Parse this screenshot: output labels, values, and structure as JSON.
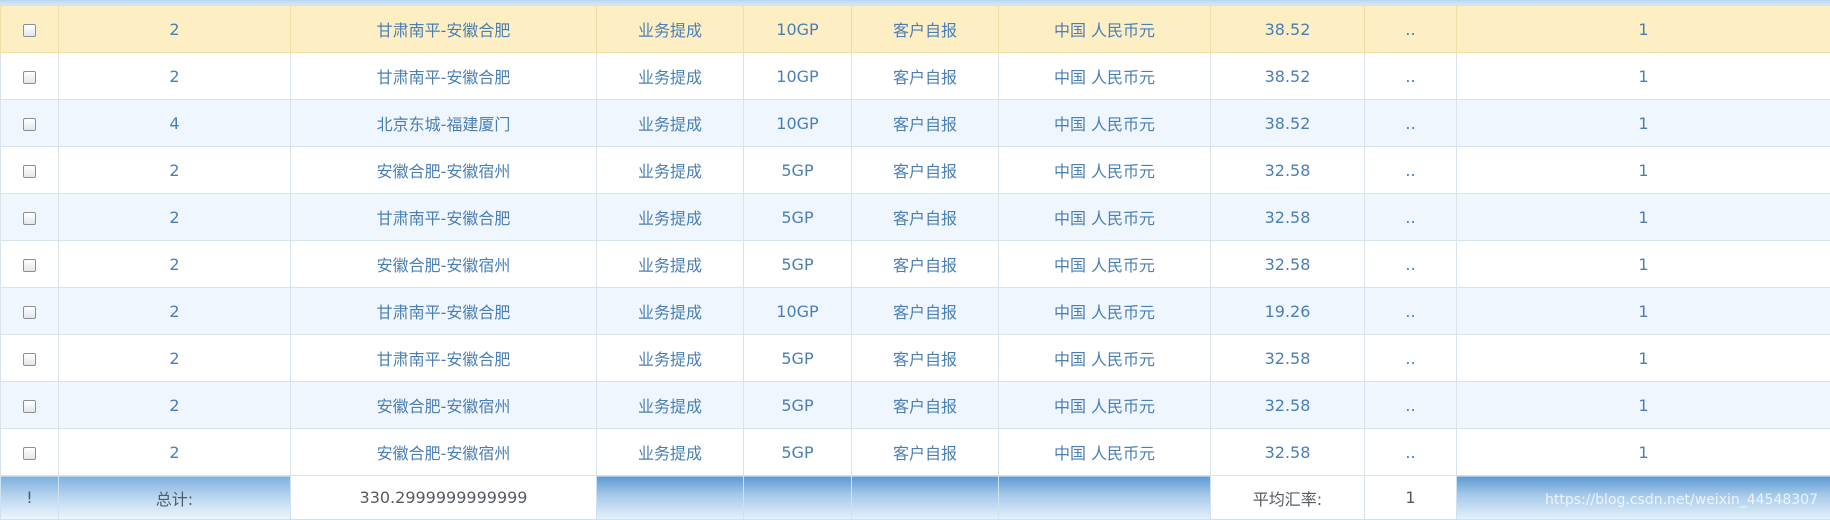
{
  "colors": {
    "text": "#4a7fb6",
    "selected_row": "#fdefc3",
    "alt_row": "#eff6fd",
    "footer_gradient_top": "#5d9ad4"
  },
  "rows": [
    {
      "qty": "2",
      "route": "甘肃南平-安徽合肥",
      "type": "业务提成",
      "container": "10GP",
      "source": "客户自报",
      "currency": "中国 人民币元",
      "amount": "38.52",
      "more": "..",
      "rate": "1"
    },
    {
      "qty": "2",
      "route": "甘肃南平-安徽合肥",
      "type": "业务提成",
      "container": "10GP",
      "source": "客户自报",
      "currency": "中国 人民币元",
      "amount": "38.52",
      "more": "..",
      "rate": "1"
    },
    {
      "qty": "4",
      "route": "北京东城-福建厦门",
      "type": "业务提成",
      "container": "10GP",
      "source": "客户自报",
      "currency": "中国 人民币元",
      "amount": "38.52",
      "more": "..",
      "rate": "1"
    },
    {
      "qty": "2",
      "route": "安徽合肥-安徽宿州",
      "type": "业务提成",
      "container": "5GP",
      "source": "客户自报",
      "currency": "中国 人民币元",
      "amount": "32.58",
      "more": "..",
      "rate": "1"
    },
    {
      "qty": "2",
      "route": "甘肃南平-安徽合肥",
      "type": "业务提成",
      "container": "5GP",
      "source": "客户自报",
      "currency": "中国 人民币元",
      "amount": "32.58",
      "more": "..",
      "rate": "1"
    },
    {
      "qty": "2",
      "route": "安徽合肥-安徽宿州",
      "type": "业务提成",
      "container": "5GP",
      "source": "客户自报",
      "currency": "中国 人民币元",
      "amount": "32.58",
      "more": "..",
      "rate": "1"
    },
    {
      "qty": "2",
      "route": "甘肃南平-安徽合肥",
      "type": "业务提成",
      "container": "10GP",
      "source": "客户自报",
      "currency": "中国 人民币元",
      "amount": "19.26",
      "more": "..",
      "rate": "1"
    },
    {
      "qty": "2",
      "route": "甘肃南平-安徽合肥",
      "type": "业务提成",
      "container": "5GP",
      "source": "客户自报",
      "currency": "中国 人民币元",
      "amount": "32.58",
      "more": "..",
      "rate": "1"
    },
    {
      "qty": "2",
      "route": "安徽合肥-安徽宿州",
      "type": "业务提成",
      "container": "5GP",
      "source": "客户自报",
      "currency": "中国 人民币元",
      "amount": "32.58",
      "more": "..",
      "rate": "1"
    },
    {
      "qty": "2",
      "route": "安徽合肥-安徽宿州",
      "type": "业务提成",
      "container": "5GP",
      "source": "客户自报",
      "currency": "中国 人民币元",
      "amount": "32.58",
      "more": "..",
      "rate": "1"
    }
  ],
  "footer": {
    "mark": "!",
    "total_label": "总计:",
    "total_value": "330.2999999999999",
    "avg_rate_label": "平均汇率:",
    "avg_rate_value": "1"
  },
  "watermark": "https://blog.csdn.net/weixin_44548307"
}
